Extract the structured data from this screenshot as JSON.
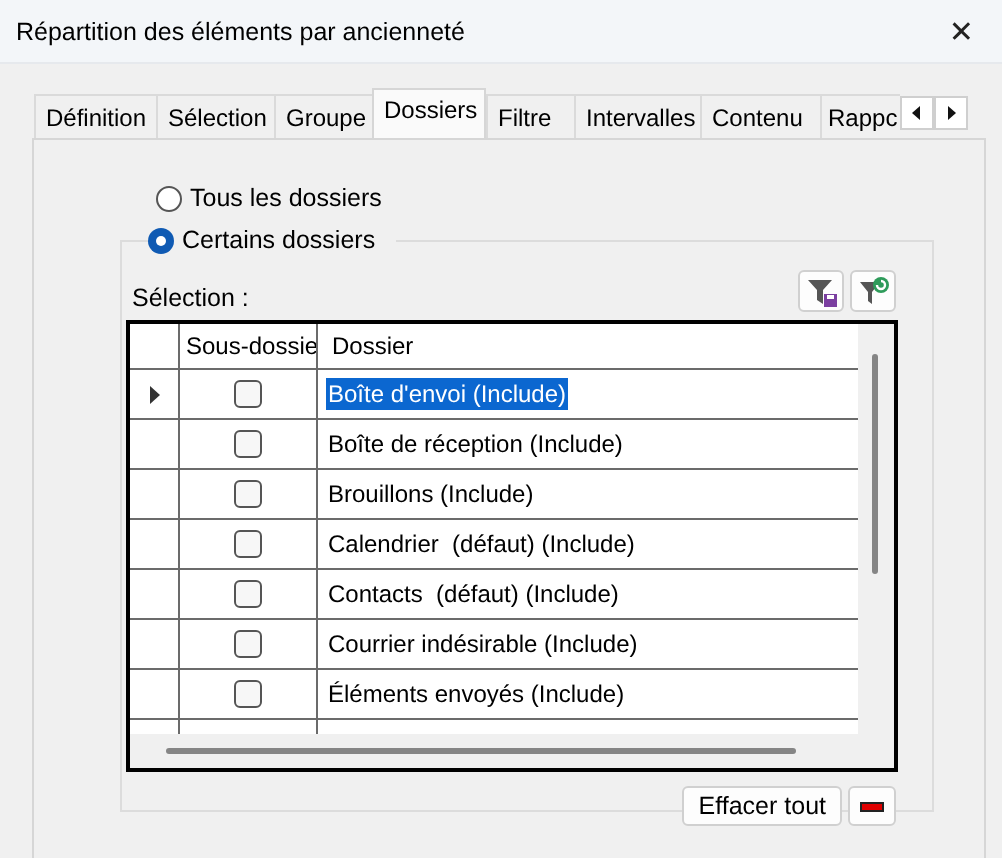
{
  "window": {
    "title": "Répartition des éléments par ancienneté",
    "close": "✕"
  },
  "tabs": [
    {
      "label": "Définition",
      "selected": false
    },
    {
      "label": "Sélection",
      "selected": false
    },
    {
      "label": "Groupe",
      "selected": false
    },
    {
      "label": "Dossiers",
      "selected": true
    },
    {
      "label": "Filtre",
      "selected": false
    },
    {
      "label": "Intervalles",
      "selected": false
    },
    {
      "label": "Contenu",
      "selected": false
    },
    {
      "label": "Rappc",
      "selected": false
    }
  ],
  "scope": [
    {
      "label": "Tous les dossiers",
      "selected": false
    },
    {
      "label": "Certains dossiers",
      "selected": true
    }
  ],
  "selection_label": "Sélection :",
  "grid": {
    "columns": [
      "Sous-dossie",
      "Dossier"
    ],
    "rows": [
      {
        "subfolders": false,
        "folder": "Boîte d'envoi (Include)",
        "selected": true
      },
      {
        "subfolders": false,
        "folder": "Boîte de réception (Include)",
        "selected": false
      },
      {
        "subfolders": false,
        "folder": "Brouillons (Include)",
        "selected": false
      },
      {
        "subfolders": false,
        "folder": "Calendrier  (défaut) (Include)",
        "selected": false
      },
      {
        "subfolders": false,
        "folder": "Contacts  (défaut) (Include)",
        "selected": false
      },
      {
        "subfolders": false,
        "folder": "Courrier indésirable (Include)",
        "selected": false
      },
      {
        "subfolders": false,
        "folder": "Éléments envoyés (Include)",
        "selected": false
      }
    ]
  },
  "buttons": {
    "clear_all": "Effacer tout"
  }
}
